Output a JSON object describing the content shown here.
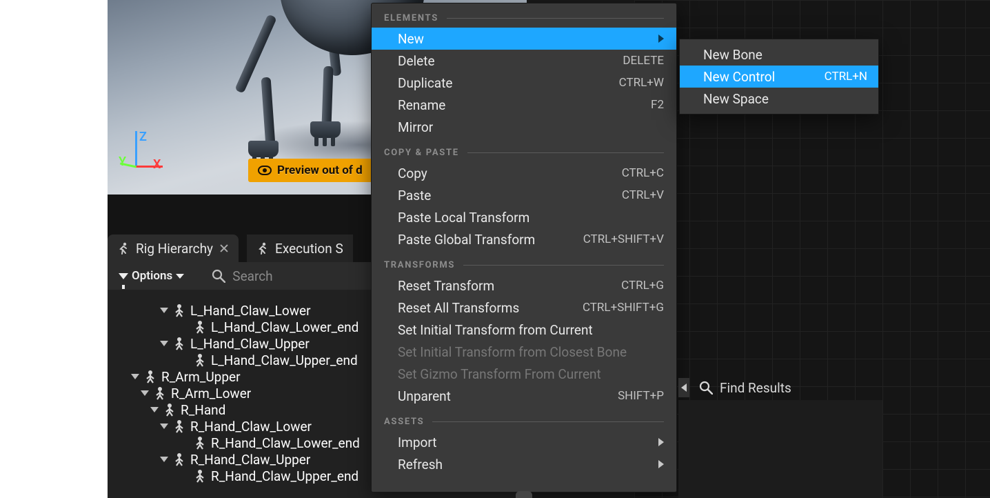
{
  "viewport": {
    "axis": {
      "x": "X",
      "y": "Y",
      "z": "Z"
    },
    "preview_banner": "Preview out of d"
  },
  "tabs": {
    "rig_hierarchy": "Rig Hierarchy",
    "execution": "Execution S"
  },
  "toolbar": {
    "options_label": "Options",
    "search_placeholder": "Search"
  },
  "hierarchy": {
    "items": [
      {
        "indent": 76,
        "expandable": true,
        "label": "L_Hand_Claw_Lower"
      },
      {
        "indent": 106,
        "expandable": false,
        "label": "L_Hand_Claw_Lower_end"
      },
      {
        "indent": 76,
        "expandable": true,
        "label": "L_Hand_Claw_Upper"
      },
      {
        "indent": 106,
        "expandable": false,
        "label": "L_Hand_Claw_Upper_end"
      },
      {
        "indent": 34,
        "expandable": true,
        "label": "R_Arm_Upper"
      },
      {
        "indent": 48,
        "expandable": true,
        "label": "R_Arm_Lower"
      },
      {
        "indent": 62,
        "expandable": true,
        "label": "R_Hand"
      },
      {
        "indent": 76,
        "expandable": true,
        "label": "R_Hand_Claw_Lower"
      },
      {
        "indent": 106,
        "expandable": false,
        "label": "R_Hand_Claw_Lower_end"
      },
      {
        "indent": 76,
        "expandable": true,
        "label": "R_Hand_Claw_Upper"
      },
      {
        "indent": 106,
        "expandable": false,
        "label": "R_Hand_Claw_Upper_end"
      }
    ]
  },
  "context_menu": {
    "sections": {
      "elements": "ELEMENTS",
      "copy_paste": "COPY & PASTE",
      "transforms": "TRANSFORMS",
      "assets": "ASSETS"
    },
    "items": {
      "new": "New",
      "delete": "Delete",
      "delete_sc": "DELETE",
      "duplicate": "Duplicate",
      "duplicate_sc": "CTRL+W",
      "rename": "Rename",
      "rename_sc": "F2",
      "mirror": "Mirror",
      "copy": "Copy",
      "copy_sc": "CTRL+C",
      "paste": "Paste",
      "paste_sc": "CTRL+V",
      "paste_local": "Paste Local Transform",
      "paste_global": "Paste Global Transform",
      "paste_global_sc": "CTRL+SHIFT+V",
      "reset_t": "Reset Transform",
      "reset_t_sc": "CTRL+G",
      "reset_all": "Reset All Transforms",
      "reset_all_sc": "CTRL+SHIFT+G",
      "set_initial_cur": "Set Initial Transform from Current",
      "set_initial_bone": "Set Initial Transform from Closest Bone",
      "set_gizmo": "Set Gizmo Transform From Current",
      "unparent": "Unparent",
      "unparent_sc": "SHIFT+P",
      "import": "Import",
      "refresh": "Refresh"
    }
  },
  "submenu": {
    "new_bone": "New Bone",
    "new_control": "New Control",
    "new_control_sc": "CTRL+N",
    "new_space": "New Space"
  },
  "bottom": {
    "find_results": "Find Results"
  }
}
